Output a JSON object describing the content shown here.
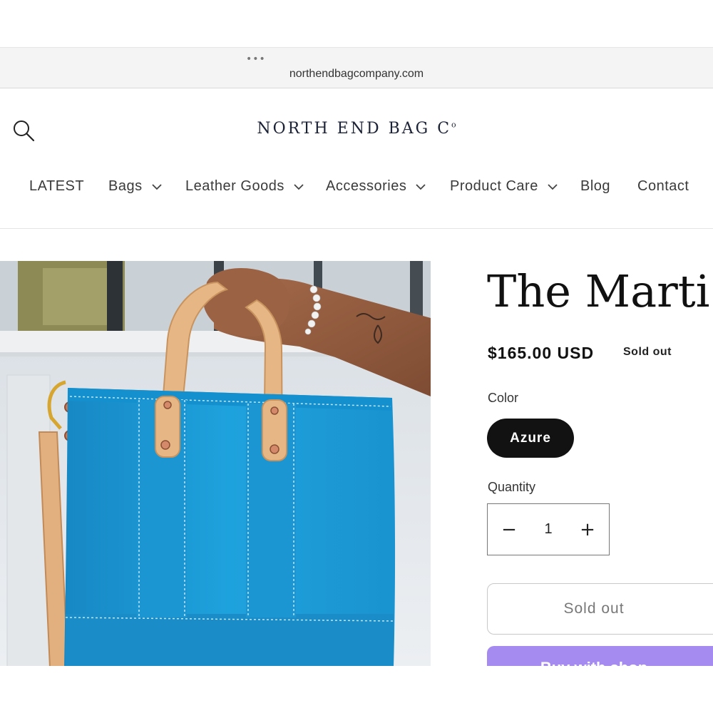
{
  "browser": {
    "dots": "•••",
    "url": "northendbagcompany.com"
  },
  "header": {
    "search_icon": "search-icon",
    "logo_text": "NORTH END BAG C",
    "logo_suffix": "o"
  },
  "nav": {
    "items": [
      {
        "label": "LATEST",
        "dropdown": false
      },
      {
        "label": "Bags",
        "dropdown": true
      },
      {
        "label": "Leather Goods",
        "dropdown": true
      },
      {
        "label": "Accessories",
        "dropdown": true
      },
      {
        "label": "Product Care",
        "dropdown": true
      },
      {
        "label": "Blog",
        "dropdown": false
      },
      {
        "label": "Contact",
        "dropdown": false
      }
    ]
  },
  "product": {
    "title": "The Marti",
    "price": "$165.00 USD",
    "badge": "Sold out",
    "color_label": "Color",
    "color_selected": "Azure",
    "quantity_label": "Quantity",
    "quantity_value": "1",
    "decrement_symbol": "−",
    "increment_symbol": "+",
    "soldout_button": "Sold out",
    "buy_button": "Buy with shop",
    "image_alt": "Azure canvas tote bag with leather handles held by a hand"
  },
  "colors": {
    "bag_blue": "#1a9ad6",
    "leather": "#e6b784",
    "buy_purple": "#a58bf0",
    "logo_navy": "#1c2236"
  }
}
